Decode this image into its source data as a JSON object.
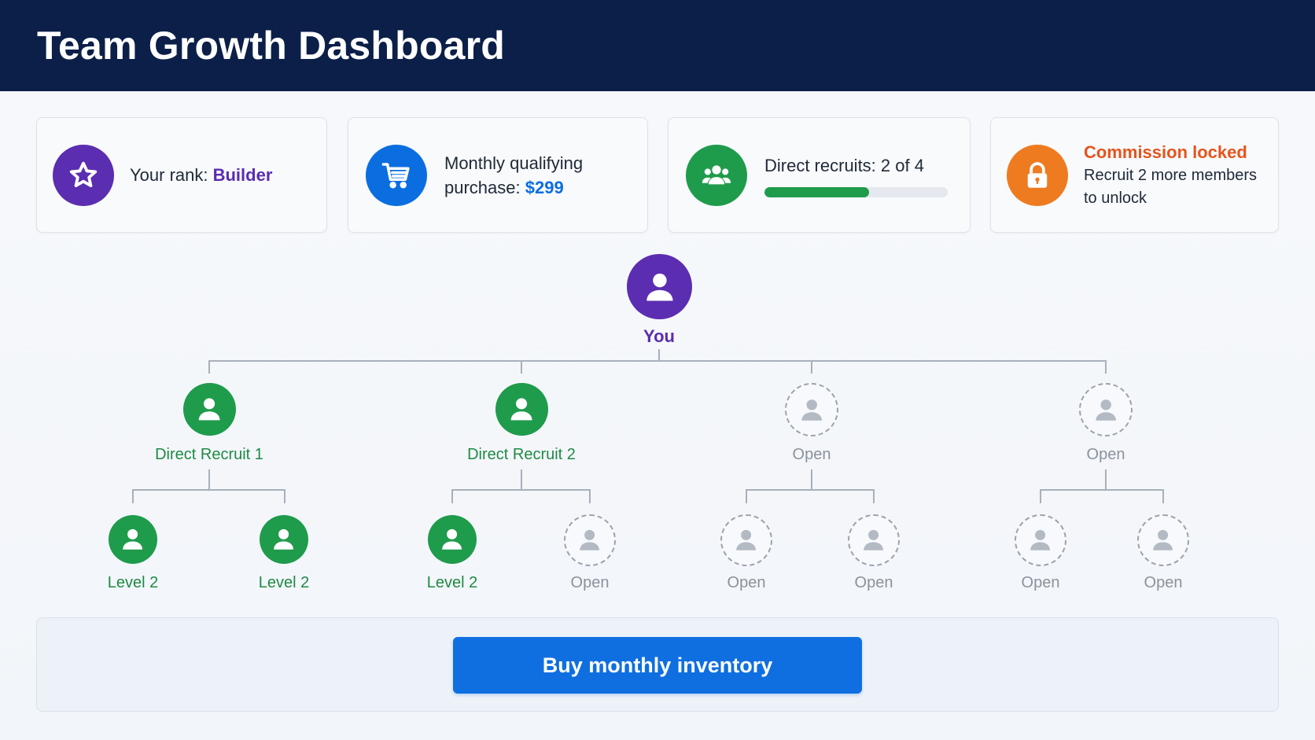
{
  "header": {
    "title": "Team Growth Dashboard"
  },
  "cards": {
    "rank": {
      "label": "Your rank:",
      "value": "Builder",
      "icon": "star-icon"
    },
    "purchase": {
      "label_line1": "Monthly qualifying",
      "label_line2": "purchase:",
      "value": "$299",
      "icon": "cart-icon"
    },
    "recruits": {
      "label": "Direct recruits: 2 of 4",
      "progress_fraction": 0.5,
      "icon": "people-icon"
    },
    "commission": {
      "title": "Commission locked",
      "line1": "Recruit 2 more members",
      "line2": "to unlock",
      "icon": "lock-icon"
    }
  },
  "tree": {
    "root": {
      "label": "You"
    },
    "level1": [
      {
        "label": "Direct Recruit 1",
        "status": "filled"
      },
      {
        "label": "Direct Recruit 2",
        "status": "filled"
      },
      {
        "label": "Open",
        "status": "open"
      },
      {
        "label": "Open",
        "status": "open"
      }
    ],
    "level2": [
      {
        "label": "Level 2",
        "status": "filled"
      },
      {
        "label": "Level 2",
        "status": "filled"
      },
      {
        "label": "Level 2",
        "status": "filled"
      },
      {
        "label": "Open",
        "status": "open"
      },
      {
        "label": "Open",
        "status": "open"
      },
      {
        "label": "Open",
        "status": "open"
      },
      {
        "label": "Open",
        "status": "open"
      },
      {
        "label": "Open",
        "status": "open"
      }
    ]
  },
  "footer": {
    "button_label": "Buy monthly inventory"
  },
  "colors": {
    "header_bg": "#0b1f48",
    "purple": "#5b2db0",
    "blue": "#0f6fe0",
    "green": "#1f9b4c",
    "orange": "#ef7b20",
    "lock_red": "#e5541c",
    "open_gray": "#9ca3af"
  }
}
